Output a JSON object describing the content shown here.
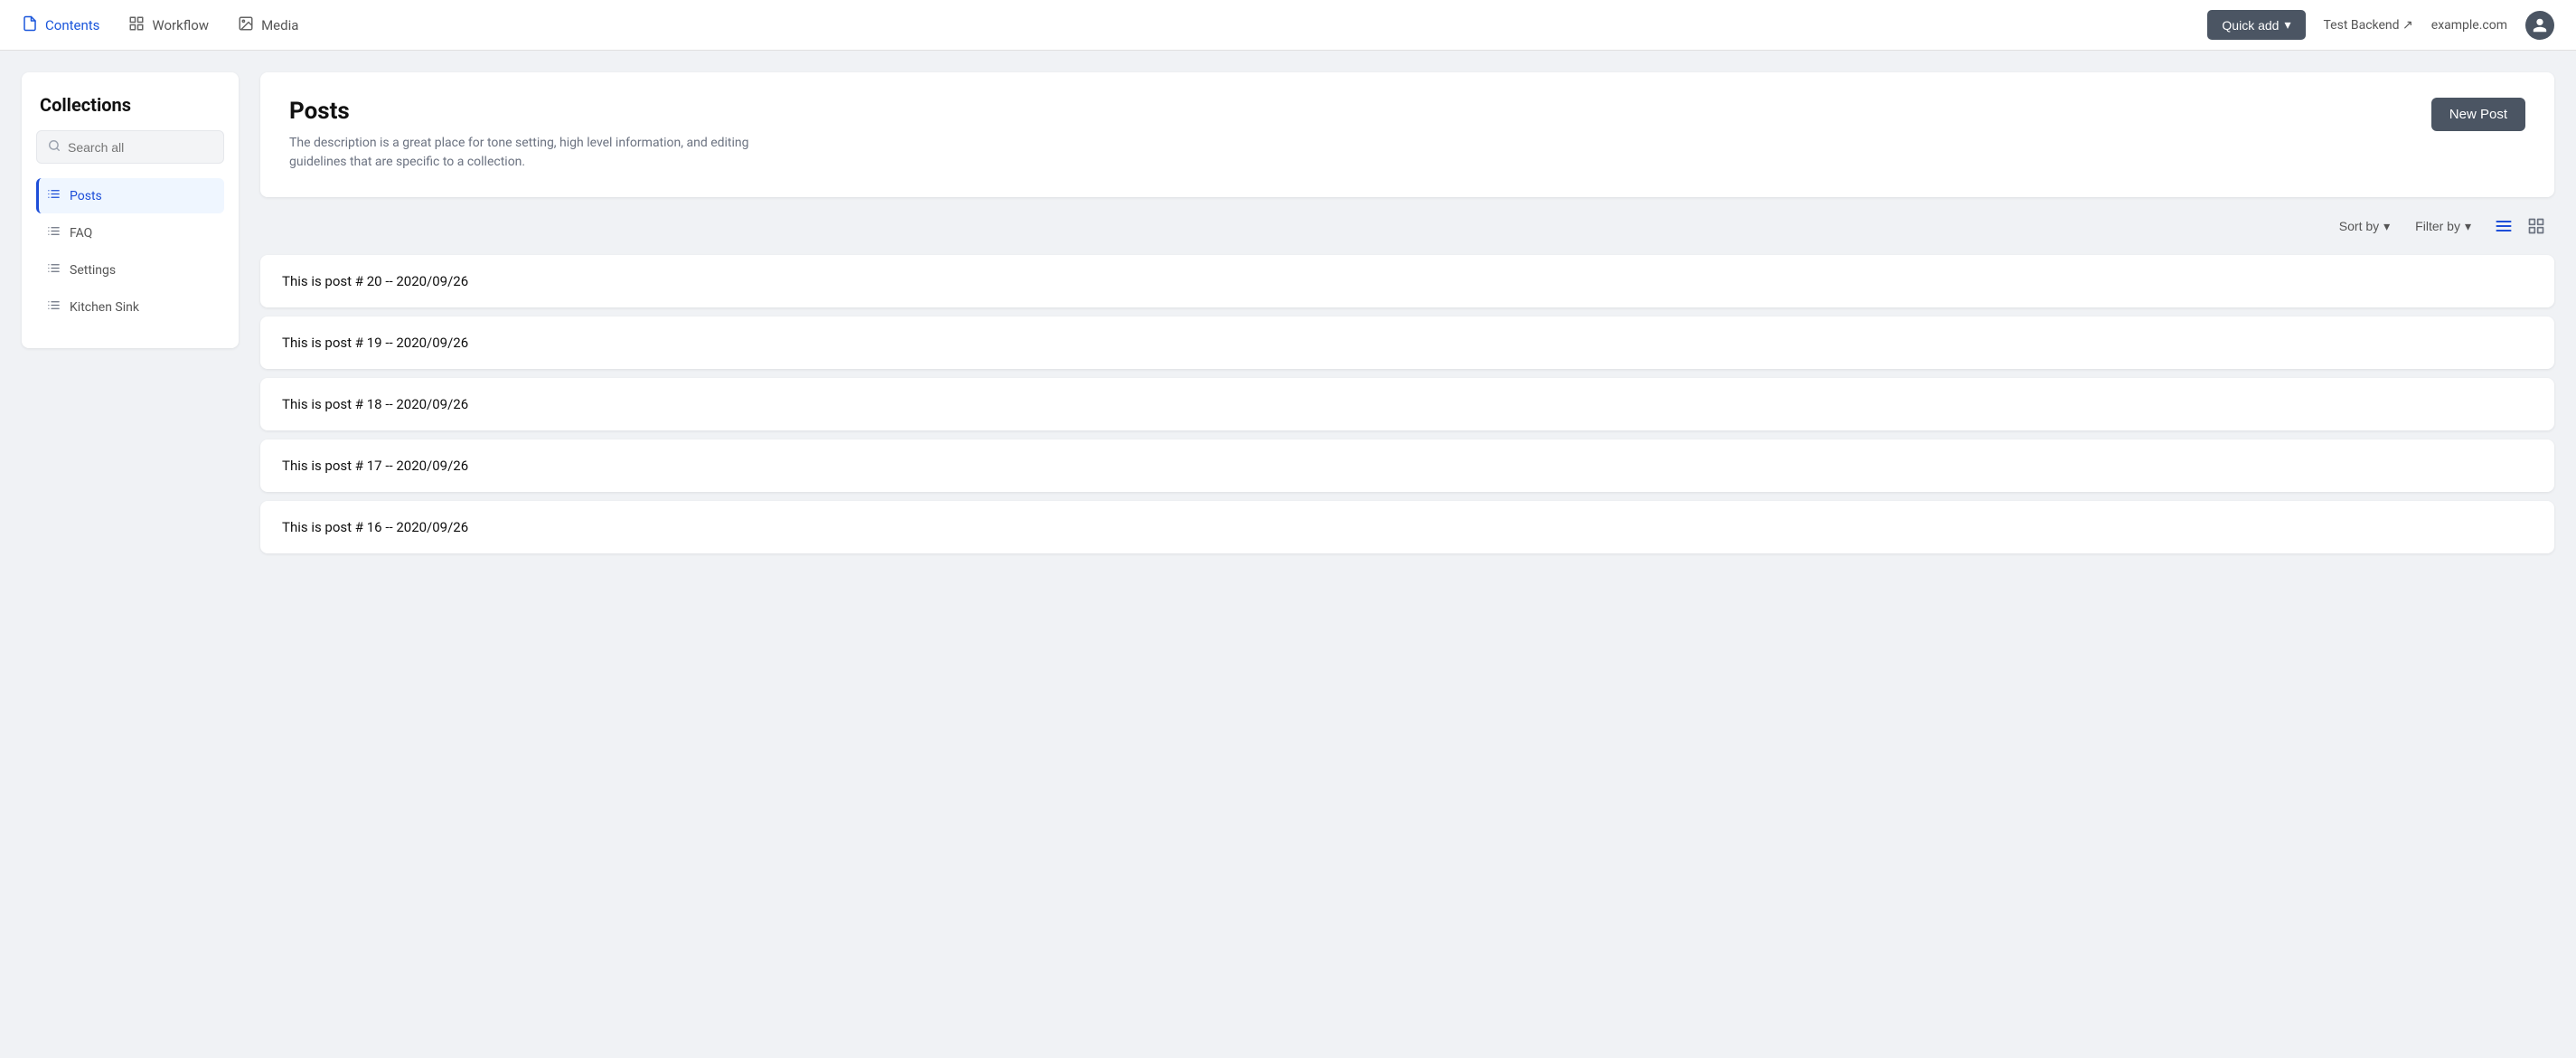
{
  "topnav": {
    "items": [
      {
        "id": "contents",
        "label": "Contents",
        "icon": "📄",
        "active": true
      },
      {
        "id": "workflow",
        "label": "Workflow",
        "icon": "📊",
        "active": false
      },
      {
        "id": "media",
        "label": "Media",
        "icon": "🖼️",
        "active": false
      }
    ],
    "quick_add_label": "Quick add",
    "quick_add_arrow": "▾",
    "backend_label": "Test Backend ↗",
    "site_label": "example.com"
  },
  "sidebar": {
    "title": "Collections",
    "search_placeholder": "Search all",
    "items": [
      {
        "id": "posts",
        "label": "Posts",
        "active": true
      },
      {
        "id": "faq",
        "label": "FAQ",
        "active": false
      },
      {
        "id": "settings",
        "label": "Settings",
        "active": false
      },
      {
        "id": "kitchen-sink",
        "label": "Kitchen Sink",
        "active": false
      }
    ]
  },
  "main": {
    "page_title": "Posts",
    "page_description": "The description is a great place for tone setting, high level information, and editing guidelines that are specific to a collection.",
    "new_post_label": "New Post",
    "sort_by_label": "Sort by",
    "filter_by_label": "Filter by",
    "posts": [
      {
        "id": 1,
        "title": "This is post # 20 -- 2020/09/26"
      },
      {
        "id": 2,
        "title": "This is post # 19 -- 2020/09/26"
      },
      {
        "id": 3,
        "title": "This is post # 18 -- 2020/09/26"
      },
      {
        "id": 4,
        "title": "This is post # 17 -- 2020/09/26"
      },
      {
        "id": 5,
        "title": "This is post # 16 -- 2020/09/26"
      }
    ]
  },
  "colors": {
    "active_nav": "#1d4ed8",
    "btn_dark": "#4b5563",
    "sidebar_active_bg": "#eff6ff"
  }
}
